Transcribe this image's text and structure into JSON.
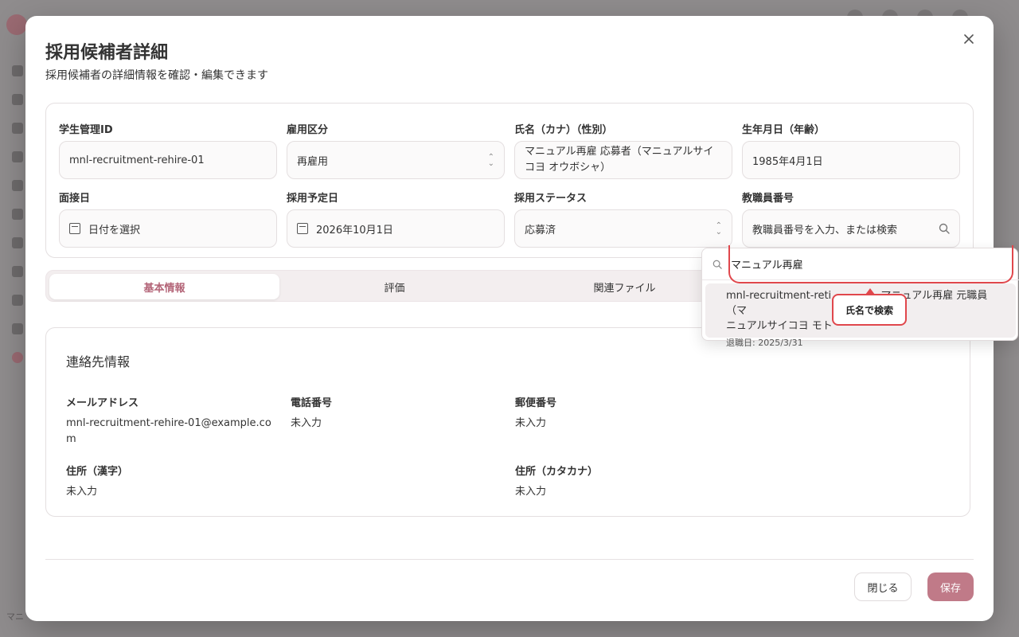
{
  "colors": {
    "accent": "#c07a88",
    "tab_active_text": "#b36477",
    "highlight": "#e0474c",
    "overlay": "#8f8c8d"
  },
  "background": {
    "bottom_text": "マニ"
  },
  "modal": {
    "title": "採用候補者詳細",
    "subtitle": "採用候補者の詳細情報を確認・編集できます",
    "close_icon": "close-icon"
  },
  "form": {
    "student_id": {
      "label": "学生管理ID",
      "value": "mnl-recruitment-rehire-01"
    },
    "employment_type": {
      "label": "雇用区分",
      "value": "再雇用"
    },
    "name": {
      "label": "氏名（カナ）（性別）",
      "value": "マニュアル再雇 応募者（マニュアルサイコヨ オウボシャ）"
    },
    "birth": {
      "label": "生年月日（年齢）",
      "value": "1985年4月1日"
    },
    "interview_date": {
      "label": "面接日",
      "placeholder": "日付を選択"
    },
    "hire_date": {
      "label": "採用予定日",
      "value": "2026年10月1日"
    },
    "status": {
      "label": "採用ステータス",
      "value": "応募済"
    },
    "staff_number": {
      "label": "教職員番号",
      "placeholder": "教職員番号を入力、または検索"
    }
  },
  "tabs": [
    {
      "label": "基本情報",
      "active": true
    },
    {
      "label": "評価",
      "active": false
    },
    {
      "label": "関連ファイル",
      "active": false
    }
  ],
  "contact": {
    "title": "連絡先情報",
    "email": {
      "label": "メールアドレス",
      "value": "mnl-recruitment-rehire-01@example.com"
    },
    "phone": {
      "label": "電話番号",
      "value": "未入力"
    },
    "postal": {
      "label": "郵便番号",
      "value": "未入力"
    },
    "address_kanji": {
      "label": "住所（漢字）",
      "value": "未入力"
    },
    "address_kana": {
      "label": "住所（カタカナ）",
      "value": "未入力"
    }
  },
  "footer": {
    "close_label": "閉じる",
    "save_label": "保存"
  },
  "dropdown": {
    "search_value": "マニュアル再雇",
    "option_title": "mnl-recruitment-reti... (マニュアル再雇 元職員（マニュアルサイコヨ モト...",
    "option_title_line1": "mnl-recruitment-reti",
    "option_title_line1b": "マニュアル再雇 元職員（マ",
    "option_title_line2": "ニュアルサイコヨ モト",
    "option_sub": "退職日: 2025/3/31"
  },
  "tooltip": {
    "text": "氏名で検索"
  }
}
